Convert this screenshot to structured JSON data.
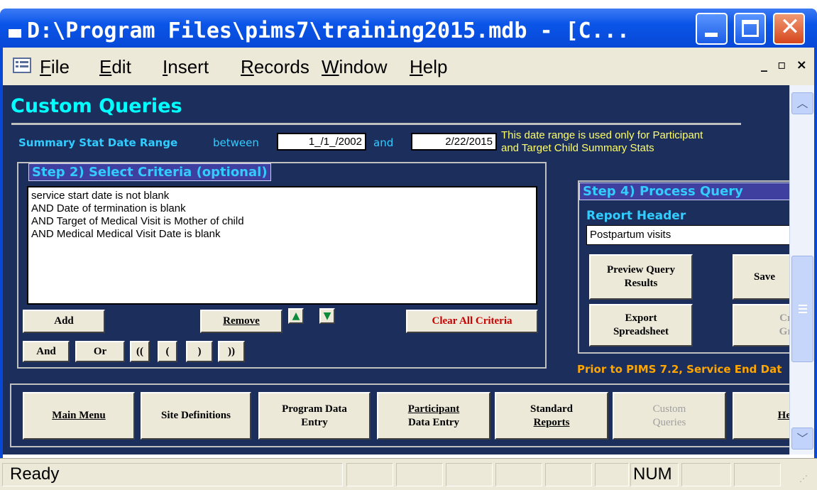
{
  "window": {
    "title": "D:\\Program Files\\pims7\\training2015.mdb - [C..."
  },
  "menu": {
    "items": [
      {
        "label": "File",
        "accel": "F",
        "rest": "ile"
      },
      {
        "label": "Edit",
        "accel": "E",
        "rest": "dit"
      },
      {
        "label": "Insert",
        "accel": "I",
        "rest": "nsert"
      },
      {
        "label": "Records",
        "accel": "R",
        "rest": "ecords"
      },
      {
        "label": "Window",
        "accel": "W",
        "rest": "indow"
      },
      {
        "label": "Help",
        "accel": "H",
        "rest": "elp"
      }
    ],
    "mdi_controls": "_ ▫ ×"
  },
  "form": {
    "title": "Custom Queries",
    "date_range": {
      "label": "Summary Stat Date Range",
      "between": "between",
      "start": "1_/1_/2002",
      "and": "and",
      "end": "2/22/2015",
      "note_line1": "This date range is used only for Participant",
      "note_line2": "and Target Child Summary Stats"
    },
    "step2": {
      "header": "Step 2) Select Criteria (optional)",
      "criteria": [
        "service start date is not blank",
        "AND Date of termination is blank",
        "AND Target of Medical Visit is Mother of child",
        "AND Medical Medical Visit Date is blank"
      ],
      "add": "Add",
      "remove": "Remove",
      "clear_all": "Clear All Criteria",
      "and": "And",
      "or": "Or",
      "double_open": "((",
      "open": "(",
      "close": ")",
      "double_close": "))"
    },
    "step4": {
      "header": "Step 4) Process Query",
      "report_header_label": "Report Header",
      "report_header_value": "Postpartum visits",
      "preview_line1": "Preview Query",
      "preview_line2": "Results",
      "save": "Save",
      "export_line1": "Export",
      "export_line2": "Spreadsheet",
      "create_line1": "Cr",
      "create_line2": "Gr"
    },
    "warning": "Prior to PIMS 7.2, Service End Dat",
    "nav": {
      "main_menu": "Main Menu",
      "site_definitions": "Site Definitions",
      "program_data_line1": "Program Data",
      "program_data_line2": "Entry",
      "participant_line1": "Participant",
      "participant_line2": "Data Entry",
      "standard_line1": "Standard",
      "standard_line2": "Reports",
      "custom_line1": "Custom",
      "custom_line2": "Queries",
      "help": "He"
    }
  },
  "status": {
    "ready": "Ready",
    "num": "NUM"
  },
  "colors": {
    "form_bg": "#1b2e5c",
    "title_cyan": "#00ffff",
    "label_cyan": "#33ccff",
    "note_yellow": "#ffff66",
    "warning_orange": "#ffa500",
    "clear_red": "#cc0000"
  }
}
